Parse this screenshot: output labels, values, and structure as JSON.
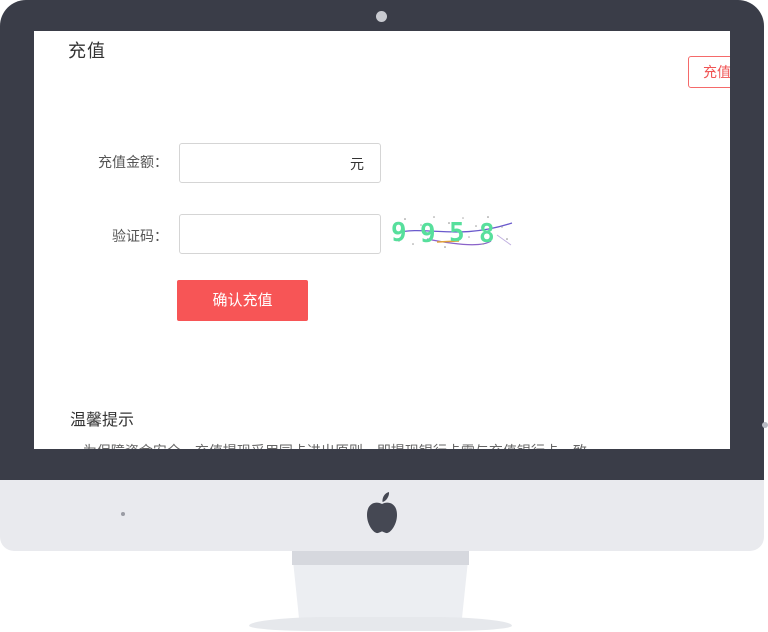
{
  "page": {
    "title": "充值",
    "top_button_label": "充值"
  },
  "form": {
    "amount_label": "充值金额：",
    "amount_unit": "元",
    "amount_value": "",
    "captcha_label": "验证码：",
    "captcha_value": "",
    "captcha_digits": [
      "9",
      "9",
      "5",
      "8"
    ],
    "submit_label": "确认充值"
  },
  "tips": {
    "title": "温馨提示",
    "line1": "· 为保障资金安全，充值提现采用同卡进出原则，即提现银行卡需与充值银行卡一致"
  },
  "colors": {
    "accent": "#f75556",
    "captcha": "#57df9c",
    "bezel": "#3a3d48"
  },
  "icons": {
    "logo": "apple-icon"
  }
}
